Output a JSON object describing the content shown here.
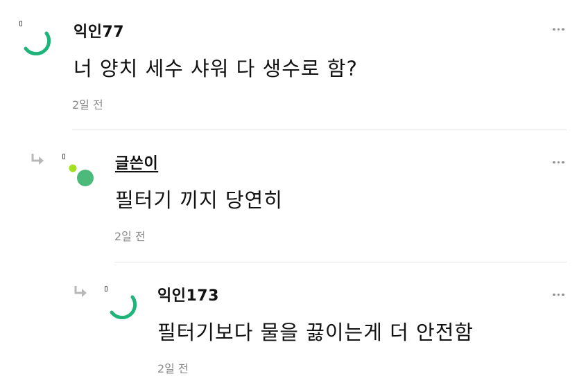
{
  "comments": [
    {
      "author": "익인77",
      "text": "너 양치 세수 샤워 다 생수로 함?",
      "time": "2일 전",
      "is_op": false,
      "depth": 0
    },
    {
      "author": "글쓴이",
      "text": "필터기 끼지 당연히",
      "time": "2일 전",
      "is_op": true,
      "depth": 1
    },
    {
      "author": "익인173",
      "text": "필터기보다 물을 끓이는게 더 안전함",
      "time": "2일 전",
      "is_op": false,
      "depth": 2
    }
  ],
  "colors": {
    "accent_green": "#1fb47a",
    "op_avatar_green": "#4cba7a",
    "op_badge_lime": "#a3e01f",
    "time_gray": "#8a8a8a",
    "divider": "#e6e6e6"
  },
  "icons": {
    "reply": "reply-arrow-icon",
    "more": "more-dots-icon"
  }
}
